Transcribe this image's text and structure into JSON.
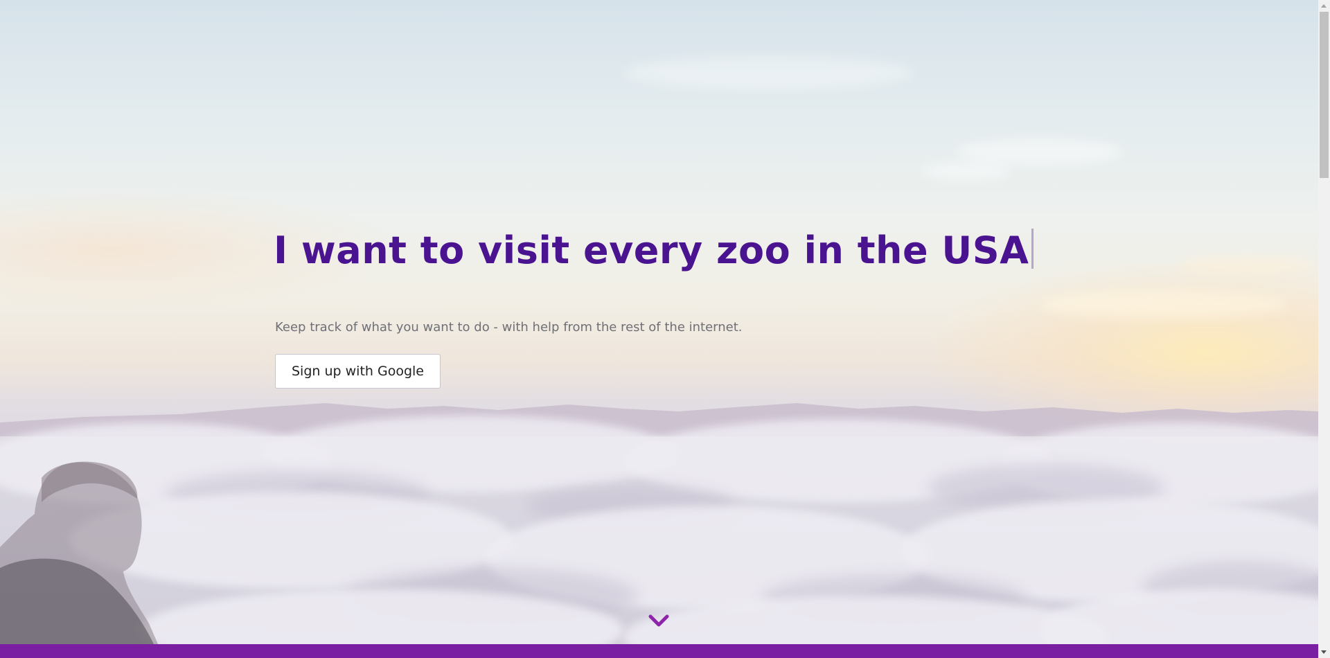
{
  "hero": {
    "headline": "I want to visit every zoo in the USA",
    "tagline": "Keep track of what you want to do - with help from the rest of the internet.",
    "signup_button_label": "Sign up with Google",
    "scroll_down_icon": "chevron-down-icon",
    "background_image": "sunrise-above-clouds-photo"
  },
  "colors": {
    "headline": "#4a1490",
    "accent": "#7a1fa2",
    "tagline": "#6f6f76",
    "chevron": "#8e24aa",
    "button_bg": "#ffffff"
  },
  "scrollbar": {
    "position": 0
  }
}
